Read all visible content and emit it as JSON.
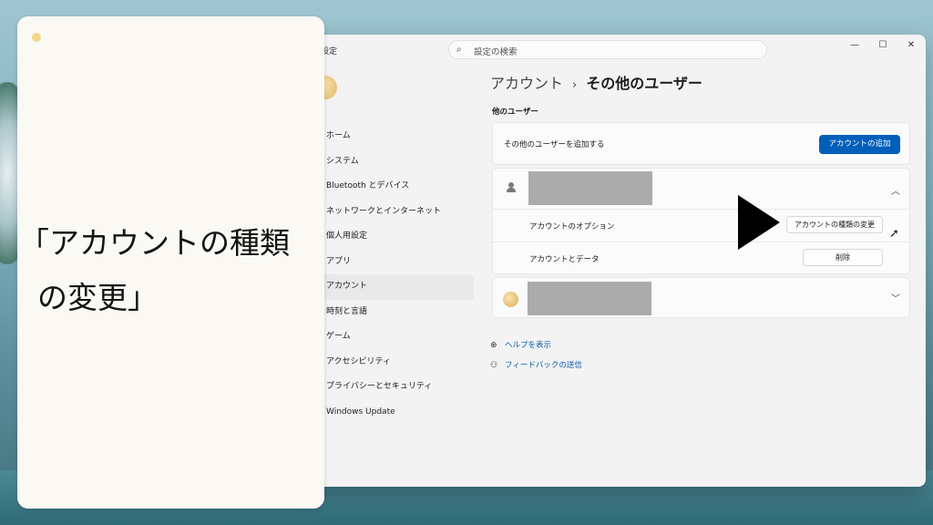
{
  "window": {
    "app_title": "設定",
    "search_placeholder": "設定の検索",
    "controls": {
      "minimize": "—",
      "maximize": "☐",
      "close": "✕"
    }
  },
  "nav": {
    "items": [
      {
        "label": "ホーム"
      },
      {
        "label": "システム"
      },
      {
        "label": "Bluetooth とデバイス"
      },
      {
        "label": "ネットワークとインターネット"
      },
      {
        "label": "個人用設定"
      },
      {
        "label": "アプリ"
      },
      {
        "label": "アカウント",
        "active": true
      },
      {
        "label": "時刻と言語"
      },
      {
        "label": "ゲーム"
      },
      {
        "label": "アクセシビリティ"
      },
      {
        "label": "プライバシーとセキュリティ"
      },
      {
        "label": "Windows Update"
      }
    ]
  },
  "breadcrumb": {
    "first": "アカウント",
    "sep": "›",
    "current": "その他のユーザー"
  },
  "section_label": "他のユーザー",
  "add_card": {
    "text": "その他のユーザーを追加する",
    "button": "アカウントの追加"
  },
  "user1": {
    "options_label": "アカウントのオプション",
    "change_type_button": "アカウントの種類の変更",
    "data_label": "アカウントとデータ",
    "delete_button": "削除"
  },
  "links": {
    "help": "ヘルプを表示",
    "feedback": "フィードバックの送信"
  },
  "caption": {
    "line1": "「アカウントの種類",
    "line2": "の変更」"
  },
  "colors": {
    "accent": "#005fb8",
    "link": "#0a5bad",
    "panel": "#fbf9f3"
  }
}
